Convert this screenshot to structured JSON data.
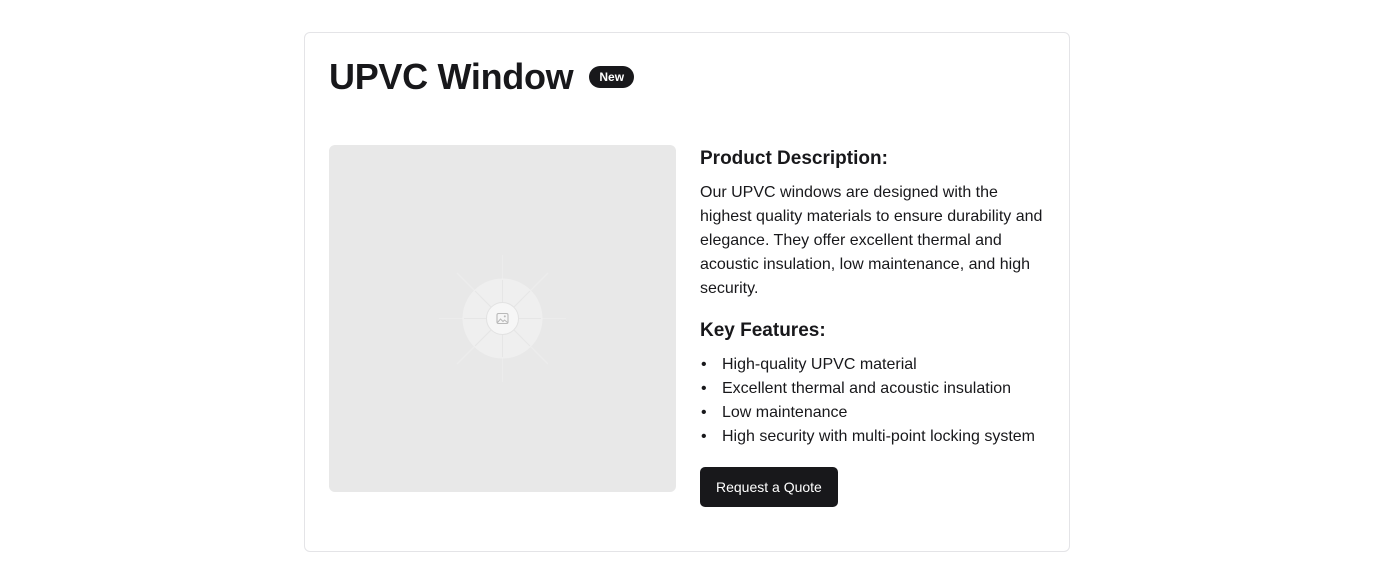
{
  "product": {
    "title": "UPVC Window",
    "badge": "New",
    "image_icon": "image-placeholder-icon"
  },
  "description": {
    "heading": "Product Description:",
    "text": "Our UPVC windows are designed with the highest quality materials to ensure durability and elegance. They offer excellent thermal and acoustic insulation, low maintenance, and high security."
  },
  "features": {
    "heading": "Key Features:",
    "items": [
      "High-quality UPVC material",
      "Excellent thermal and acoustic insulation",
      "Low maintenance",
      "High security with multi-point locking system"
    ]
  },
  "actions": {
    "quote_label": "Request a Quote"
  },
  "colors": {
    "primary": "#18181b",
    "placeholder_bg": "#e8e8e8",
    "border": "#e4e4e7"
  }
}
